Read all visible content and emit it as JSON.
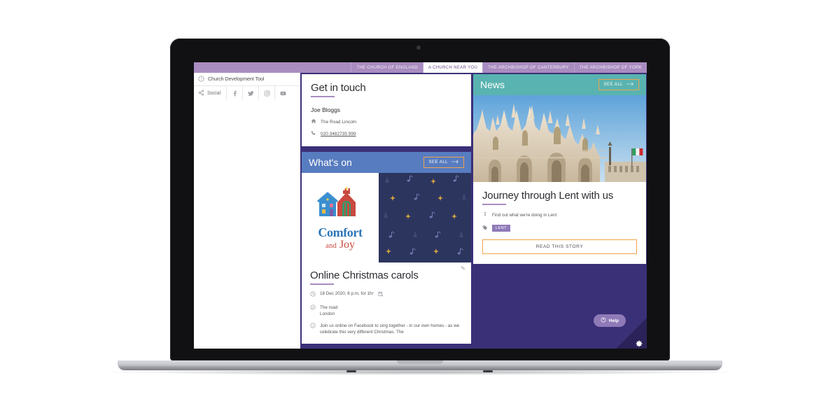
{
  "device": {
    "type": "laptop",
    "screen_label": "laptop-screen"
  },
  "topnav": {
    "items": [
      {
        "label": "THE CHURCH OF ENGLAND",
        "active": false
      },
      {
        "label": "A CHURCH NEAR YOU",
        "active": true
      },
      {
        "label": "THE ARCHBISHOP OF CANTERBURY",
        "active": false
      },
      {
        "label": "THE ARCHBISHOP OF YORK",
        "active": false
      }
    ]
  },
  "utility": {
    "dev_tool_label": "Church Development Tool",
    "dev_tool_icon": "question-circle-icon",
    "social_label": "Social",
    "share_icon": "share-icon",
    "social_icons": [
      {
        "name": "facebook-icon",
        "label": "f"
      },
      {
        "name": "twitter-icon",
        "label": "Twitter"
      },
      {
        "name": "instagram-icon",
        "label": "Instagram"
      },
      {
        "name": "youtube-icon",
        "label": "YouTube"
      }
    ]
  },
  "get_in_touch": {
    "title": "Get in touch",
    "contact_name": "Joe Bloggs",
    "address": "The Road Lincoln",
    "address_icon": "home-icon",
    "phone": "020 3482735 999",
    "phone_icon": "phone-icon"
  },
  "whats_on": {
    "title": "What's on",
    "see_all_label": "SEE ALL",
    "see_all_icon": "arrow-right-icon",
    "artwork": {
      "word_top": "Comfort",
      "word_and": "and",
      "word_bottom": "Joy",
      "alt": "comfort-and-joy-illustration"
    },
    "event": {
      "edit_icon": "pencil-icon",
      "title": "Online Christmas carols",
      "datetime": "18 Dec 2020, 6 p.m. for 1hr",
      "datetime_icon": "clock-icon",
      "add_to_calendar_icon": "calendar-add-icon",
      "location_icon": "pin-icon",
      "location_line1": "The road",
      "location_line2": "London",
      "description_icon": "info-icon",
      "description": "Join us online on Facebook to sing together - in our own homes - as we celebrate this very different Christmas. The"
    }
  },
  "news": {
    "title": "News",
    "see_all_label": "SEE ALL",
    "see_all_icon": "arrow-right-icon",
    "photo_alt": "milan-cathedral-photo",
    "story": {
      "title": "Journey through Lent with us",
      "summary": "Find out what we're doing in Lent",
      "summary_icon": "megaphone-icon",
      "tag_icon": "tag-icon",
      "tag": "LENT",
      "cta_label": "READ THIS STORY"
    }
  },
  "help": {
    "label": "Help",
    "icon": "question-circle-icon"
  },
  "settings": {
    "icon": "gear-icon"
  },
  "colors": {
    "topbar": "#a98cc0",
    "page_background": "#3a3078",
    "whats_on_header": "#587cc0",
    "news_header": "#59b3b0",
    "accent_orange": "#f0a24a",
    "tag_purple": "#8f7ab8",
    "rule_purple": "#a98cc0"
  }
}
